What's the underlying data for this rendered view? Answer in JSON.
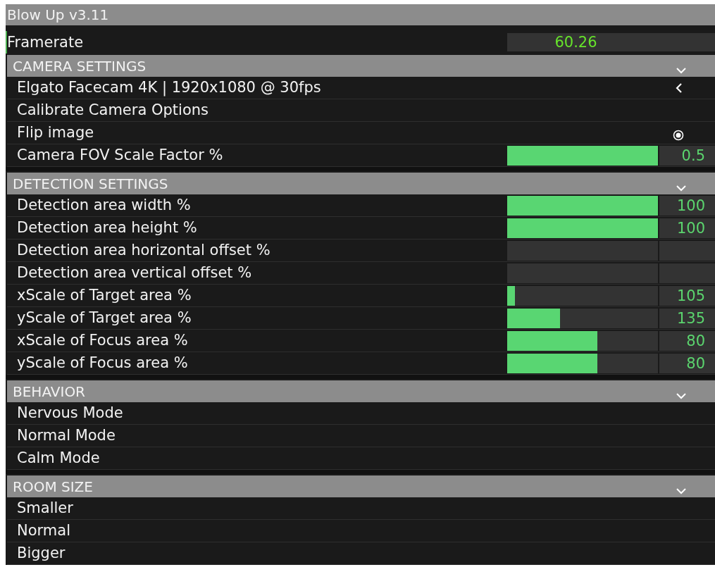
{
  "window": {
    "title": "Blow Up v3.11"
  },
  "framerate": {
    "label": "Framerate",
    "value": "60.26"
  },
  "sections": [
    {
      "title": "CAMERA SETTINGS",
      "expanded": true,
      "items": [
        {
          "kind": "dropdown",
          "label": "Elgato Facecam 4K | 1920x1080 @ 30fps",
          "expanded": false
        },
        {
          "kind": "text",
          "label": "Calibrate Camera Options"
        },
        {
          "kind": "toggle",
          "label": "Flip image",
          "checked": true
        },
        {
          "kind": "slider",
          "label": "Camera FOV Scale Factor %",
          "level": 1,
          "value": "0.5"
        }
      ]
    },
    {
      "title": "DETECTION SETTINGS",
      "expanded": true,
      "items": [
        {
          "kind": "slider",
          "label": "Detection area width %",
          "level": 1,
          "value": "100"
        },
        {
          "kind": "slider",
          "label": "Detection area height %",
          "level": 1,
          "value": "100"
        },
        {
          "kind": "slider",
          "label": "Detection area horizontal offset %"
        },
        {
          "kind": "slider",
          "label": "Detection area vertical offset %"
        },
        {
          "kind": "slider",
          "label": "xScale of Target area %",
          "level": 0.05,
          "value": "105"
        },
        {
          "kind": "slider",
          "label": "yScale of Target area %",
          "level": 0.35,
          "value": "135"
        },
        {
          "kind": "slider",
          "label": "xScale of Focus area %",
          "level": 0.6,
          "value": "80"
        },
        {
          "kind": "slider",
          "label": "yScale of Focus area %",
          "level": 0.6,
          "value": "80"
        }
      ]
    },
    {
      "title": "BEHAVIOR",
      "expanded": true,
      "items": [
        {
          "kind": "text",
          "label": "Nervous Mode"
        },
        {
          "kind": "text",
          "label": "Normal Mode"
        },
        {
          "kind": "text",
          "label": "Calm Mode"
        }
      ]
    },
    {
      "title": "ROOM SIZE",
      "expanded": true,
      "items": [
        {
          "kind": "text",
          "label": "Smaller"
        },
        {
          "kind": "text",
          "label": "Normal"
        },
        {
          "kind": "text",
          "label": "Bigger"
        }
      ]
    }
  ]
}
